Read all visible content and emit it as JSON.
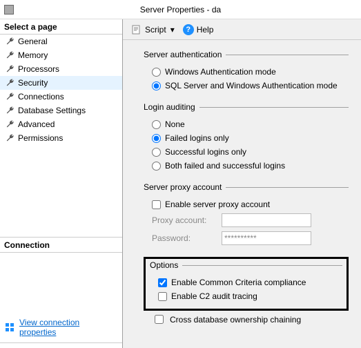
{
  "window": {
    "title": "Server Properties - da"
  },
  "sidebar": {
    "header": "Select a page",
    "items": [
      {
        "label": "General"
      },
      {
        "label": "Memory"
      },
      {
        "label": "Processors"
      },
      {
        "label": "Security"
      },
      {
        "label": "Connections"
      },
      {
        "label": "Database Settings"
      },
      {
        "label": "Advanced"
      },
      {
        "label": "Permissions"
      }
    ],
    "connection_header": "Connection",
    "connection_link": "View connection properties"
  },
  "toolbar": {
    "script_label": "Script",
    "help_label": "Help"
  },
  "auth": {
    "legend": "Server authentication",
    "mode_windows": "Windows Authentication mode",
    "mode_sql": "SQL Server and Windows Authentication mode"
  },
  "audit": {
    "legend": "Login auditing",
    "none": "None",
    "failed": "Failed logins only",
    "success": "Successful logins only",
    "both": "Both failed and successful logins"
  },
  "proxy": {
    "legend": "Server proxy account",
    "enable": "Enable server proxy account",
    "account_label": "Proxy account:",
    "password_label": "Password:",
    "password_value": "**********"
  },
  "options": {
    "legend": "Options",
    "ccc": "Enable Common Criteria compliance",
    "c2": "Enable C2 audit tracing",
    "crossdb": "Cross database ownership chaining"
  }
}
